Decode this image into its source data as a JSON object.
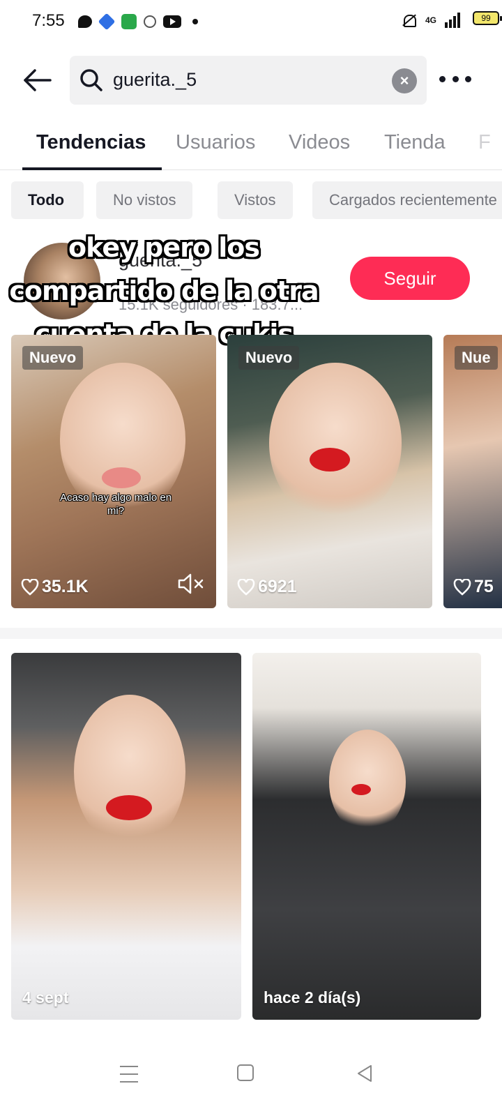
{
  "status_bar": {
    "time": "7:55",
    "network": "4G",
    "battery": "99"
  },
  "search": {
    "query": "guerita._5"
  },
  "tabs": [
    {
      "label": "Tendencias",
      "active": true
    },
    {
      "label": "Usuarios",
      "active": false
    },
    {
      "label": "Videos",
      "active": false
    },
    {
      "label": "Tienda",
      "active": false
    },
    {
      "label": "F",
      "active": false
    }
  ],
  "filters": [
    {
      "label": "Todo",
      "active": true
    },
    {
      "label": "No vistos",
      "active": false
    },
    {
      "label": "Vistos",
      "active": false
    },
    {
      "label": "Cargados recientemente",
      "active": false
    }
  ],
  "user": {
    "username": "guerita._5",
    "meta": "15.1K seguidores · 183.7...",
    "follow_label": "Seguir"
  },
  "overlay_caption": {
    "line1": "okey pero los",
    "line2": "compartido de la otra",
    "line3": "cuenta de la cukis"
  },
  "videos": [
    {
      "badge": "Nuevo",
      "likes": "35.1K",
      "caption_line1": "Acaso hay algo malo en",
      "caption_line2": "mi?",
      "muted": true
    },
    {
      "badge": "Nuevo",
      "likes": "6921"
    },
    {
      "badge": "Nue",
      "likes": "75"
    }
  ],
  "grid": [
    {
      "date": "4 sept"
    },
    {
      "date": "hace 2 día(s)"
    }
  ],
  "colors": {
    "accent": "#fe2c55",
    "text_primary": "#161823",
    "text_secondary": "#8a8b91"
  }
}
